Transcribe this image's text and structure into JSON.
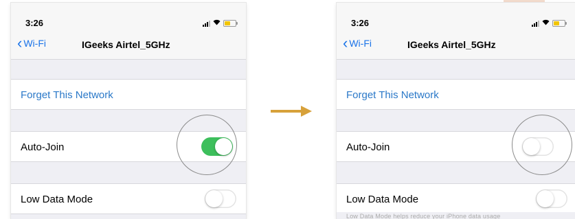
{
  "colors": {
    "link": "#2a78c8",
    "toggle_on": "#3dbf5c",
    "arrow": "#d7a13a",
    "battery": "#f2c500"
  },
  "screens": [
    {
      "id": "before",
      "status": {
        "time": "3:26",
        "icons": [
          "signal-icon",
          "wifi-icon",
          "battery-icon"
        ]
      },
      "nav": {
        "back_label": "Wi-Fi",
        "title": "IGeeks Airtel_5GHz"
      },
      "forget_label": "Forget This Network",
      "auto_join": {
        "label": "Auto-Join",
        "state": "on"
      },
      "low_data": {
        "label": "Low Data Mode",
        "state": "off"
      }
    },
    {
      "id": "after",
      "status": {
        "time": "3:26",
        "icons": [
          "signal-icon",
          "wifi-icon",
          "battery-icon"
        ]
      },
      "nav": {
        "back_label": "Wi-Fi",
        "title": "IGeeks Airtel_5GHz"
      },
      "forget_label": "Forget This Network",
      "auto_join": {
        "label": "Auto-Join",
        "state": "off"
      },
      "low_data": {
        "label": "Low Data Mode",
        "state": "off"
      },
      "footer_hint": "Low Data Mode helps reduce your iPhone data usage"
    }
  ],
  "arrow_icon": "right-arrow-icon"
}
